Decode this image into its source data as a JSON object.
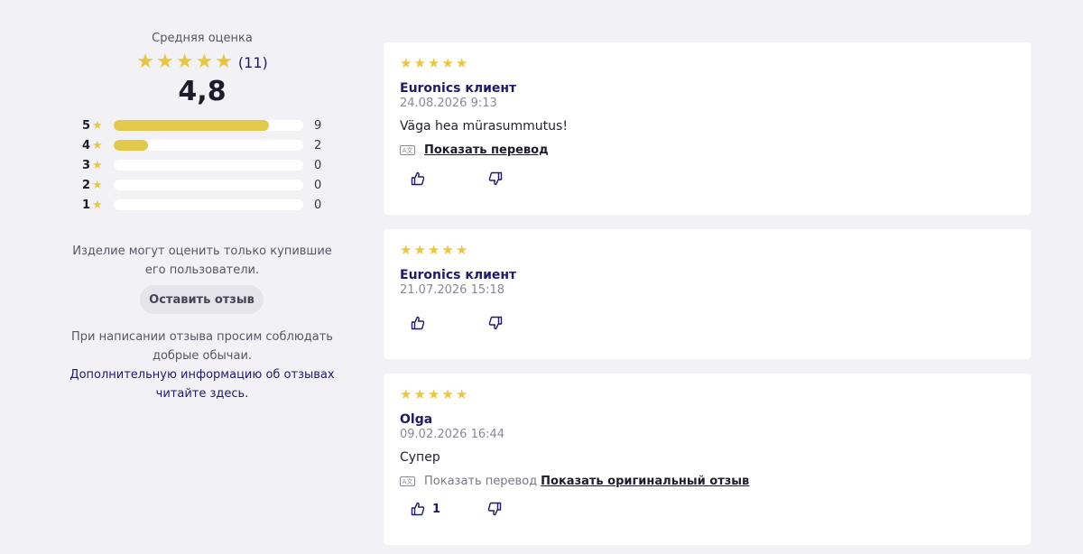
{
  "summary": {
    "title": "Средняя оценка",
    "count": "(11)",
    "average": "4,8",
    "stars": 5,
    "distribution": [
      {
        "stars": "5",
        "count": "9",
        "fraction": 0.82
      },
      {
        "stars": "4",
        "count": "2",
        "fraction": 0.18
      },
      {
        "stars": "3",
        "count": "0",
        "fraction": 0
      },
      {
        "stars": "2",
        "count": "0",
        "fraction": 0
      },
      {
        "stars": "1",
        "count": "0",
        "fraction": 0
      }
    ],
    "only_buyers_text": "Изделие могут оценить только купившие его пользователи.",
    "leave_review_label": "Оставить отзыв",
    "etiquette_text": "При написании отзыва просим соблюдать добрые обычаи.",
    "info_link_text": "Дополнительную информацию об отзывах читайте здесь."
  },
  "reviews": [
    {
      "rating": 5,
      "author": "Euronics клиент",
      "date": "24.08.2026 9:13",
      "text": "Väga hea mürasummutus!",
      "translate_label": "Показать перевод",
      "like_count": ""
    },
    {
      "rating": 5,
      "author": "Euronics клиент",
      "date": "21.07.2026 15:18",
      "text": "",
      "like_count": ""
    },
    {
      "rating": 5,
      "author": "Olga",
      "date": "09.02.2026 16:44",
      "text": "Супер",
      "translate_label": "Показать перевод",
      "original_label": "Показать оригинальный отзыв",
      "like_count": "1"
    }
  ],
  "icons": {
    "star": "star-icon",
    "translate": "translate-icon",
    "like": "thumbs-up-icon",
    "dislike": "thumbs-down-icon"
  },
  "colors": {
    "star": "#e8c73d",
    "bar_fill": "#e2c84b",
    "brand_navy": "#1d1a6b",
    "background": "#f2f2f6"
  }
}
